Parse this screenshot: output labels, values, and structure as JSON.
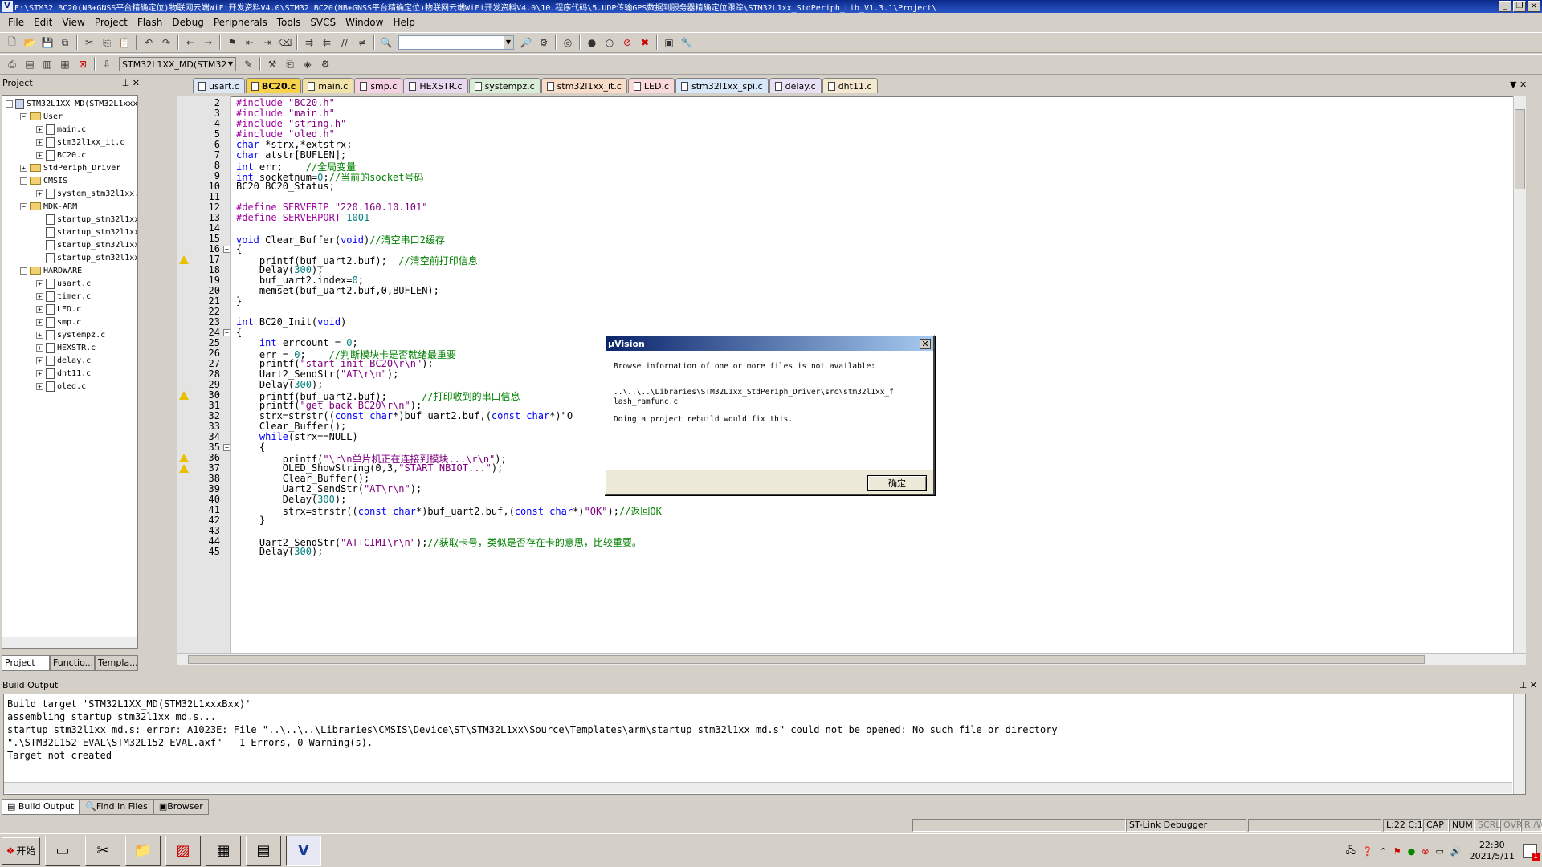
{
  "window": {
    "title": "E:\\STM32 BC20(NB+GNSS平台精确定位)物联网云端WiFi开发资料V4.0\\STM32 BC20(NB+GNSS平台精确定位)物联网云端WiFi开发资料V4.0\\10.程序代码\\5.UDP传输GPS数据到服务器精确定位跟踪\\STM32L1xx_StdPeriph_Lib_V1.3.1\\Project\\"
  },
  "menu": [
    "File",
    "Edit",
    "View",
    "Project",
    "Flash",
    "Debug",
    "Peripherals",
    "Tools",
    "SVCS",
    "Window",
    "Help"
  ],
  "toolbar": {
    "target_combo": "STM32L1XX_MD(STM32L1"
  },
  "project_panel": {
    "title": "Project",
    "root": "STM32L1XX_MD(STM32L1xxxBxx)",
    "groups": [
      {
        "name": "User",
        "files": [
          "main.c",
          "stm32l1xx_it.c",
          "BC20.c"
        ]
      },
      {
        "name": "StdPeriph_Driver",
        "files": []
      },
      {
        "name": "CMSIS",
        "files": [
          "system_stm32l1xx.c"
        ]
      },
      {
        "name": "MDK-ARM",
        "files": [
          "startup_stm32l1xx_md.",
          "startup_stm32l1xx_mdp",
          "startup_stm32l1xx_hd.",
          "startup_stm32l1xx_xl."
        ]
      },
      {
        "name": "HARDWARE",
        "files": [
          "usart.c",
          "timer.c",
          "LED.c",
          "smp.c",
          "systempz.c",
          "HEXSTR.c",
          "delay.c",
          "dht11.c",
          "oled.c"
        ]
      }
    ],
    "tabs": [
      "Project",
      "Functio...",
      "Templa..."
    ]
  },
  "file_tabs": [
    {
      "name": "usart.c",
      "color": "#dce6f5"
    },
    {
      "name": "BC20.c",
      "color": "#f7e28a"
    },
    {
      "name": "main.c",
      "color": "#f0e2a8"
    },
    {
      "name": "smp.c",
      "color": "#f5d0e0"
    },
    {
      "name": "HEXSTR.c",
      "color": "#e8d8f0"
    },
    {
      "name": "systempz.c",
      "color": "#d8ecd8"
    },
    {
      "name": "stm32l1xx_it.c",
      "color": "#f8dcc8"
    },
    {
      "name": "LED.c",
      "color": "#f8d8d8"
    },
    {
      "name": "stm32l1xx_spi.c",
      "color": "#d8e8f8"
    },
    {
      "name": "delay.c",
      "color": "#e8e0f4"
    },
    {
      "name": "dht11.c",
      "color": "#f4e8d0"
    }
  ],
  "code_lines": [
    {
      "n": "2",
      "t": "#include \"BC20.h\""
    },
    {
      "n": "3",
      "t": "#include \"main.h\""
    },
    {
      "n": "4",
      "t": "#include \"string.h\""
    },
    {
      "n": "5",
      "t": "#include \"oled.h\""
    },
    {
      "n": "6",
      "t": "char *strx,*extstrx;"
    },
    {
      "n": "7",
      "t": "char atstr[BUFLEN];"
    },
    {
      "n": "8",
      "t": "int err;    //全局变量"
    },
    {
      "n": "9",
      "t": "int socketnum=0;//当前的socket号码"
    },
    {
      "n": "10",
      "t": "BC20 BC20_Status;"
    },
    {
      "n": "11",
      "t": ""
    },
    {
      "n": "12",
      "t": "#define SERVERIP \"220.160.10.101\""
    },
    {
      "n": "13",
      "t": "#define SERVERPORT 1001"
    },
    {
      "n": "14",
      "t": ""
    },
    {
      "n": "15",
      "t": "void Clear_Buffer(void)//清空串口2缓存"
    },
    {
      "n": "16",
      "t": "{"
    },
    {
      "n": "17",
      "t": "    printf(buf_uart2.buf);  //清空前打印信息"
    },
    {
      "n": "18",
      "t": "    Delay(300);"
    },
    {
      "n": "19",
      "t": "    buf_uart2.index=0;"
    },
    {
      "n": "20",
      "t": "    memset(buf_uart2.buf,0,BUFLEN);"
    },
    {
      "n": "21",
      "t": "}"
    },
    {
      "n": "22",
      "t": ""
    },
    {
      "n": "23",
      "t": "int BC20_Init(void)"
    },
    {
      "n": "24",
      "t": "{"
    },
    {
      "n": "25",
      "t": "    int errcount = 0;"
    },
    {
      "n": "26",
      "t": "    err = 0;    //判断模块卡是否就绪最重要"
    },
    {
      "n": "27",
      "t": "    printf(\"start init BC20\\r\\n\");"
    },
    {
      "n": "28",
      "t": "    Uart2_SendStr(\"AT\\r\\n\");"
    },
    {
      "n": "29",
      "t": "    Delay(300);"
    },
    {
      "n": "30",
      "t": "    printf(buf_uart2.buf);      //打印收到的串口信息"
    },
    {
      "n": "31",
      "t": "    printf(\"get back BC20\\r\\n\");"
    },
    {
      "n": "32",
      "t": "    strx=strstr((const char*)buf_uart2.buf,(const char*)\"O"
    },
    {
      "n": "33",
      "t": "    Clear_Buffer();"
    },
    {
      "n": "34",
      "t": "    while(strx==NULL)"
    },
    {
      "n": "35",
      "t": "    {"
    },
    {
      "n": "36",
      "t": "        printf(\"\\r\\n单片机正在连接到模块...\\r\\n\");"
    },
    {
      "n": "37",
      "t": "        OLED_ShowString(0,3,\"START NBIOT...\");"
    },
    {
      "n": "38",
      "t": "        Clear_Buffer();"
    },
    {
      "n": "39",
      "t": "        Uart2_SendStr(\"AT\\r\\n\");"
    },
    {
      "n": "40",
      "t": "        Delay(300);"
    },
    {
      "n": "41",
      "t": "        strx=strstr((const char*)buf_uart2.buf,(const char*)\"OK\");//返回OK"
    },
    {
      "n": "42",
      "t": "    }"
    },
    {
      "n": "43",
      "t": ""
    },
    {
      "n": "44",
      "t": "    Uart2_SendStr(\"AT+CIMI\\r\\n\");//获取卡号，类似是否存在卡的意思，比较重要。"
    },
    {
      "n": "45",
      "t": "    Delay(300);"
    }
  ],
  "dialog": {
    "title": "µVision",
    "line1": "Browse information of one or more files is not available:",
    "line2": "..\\..\\..\\Libraries\\STM32L1xx_StdPeriph_Driver\\src\\stm32l1xx_f",
    "line3": "lash_ramfunc.c",
    "line4": "Doing a project rebuild would fix this.",
    "ok": "确定"
  },
  "build_output": {
    "title": "Build Output",
    "lines": [
      "Build target 'STM32L1XX_MD(STM32L1xxxBxx)'",
      "assembling startup_stm32l1xx_md.s...",
      "startup_stm32l1xx_md.s: error: A1023E: File \"..\\..\\..\\Libraries\\CMSIS\\Device\\ST\\STM32L1xx\\Source\\Templates\\arm\\startup_stm32l1xx_md.s\" could not be opened: No such file or directory",
      "\".\\STM32L152-EVAL\\STM32L152-EVAL.axf\" - 1 Errors, 0 Warning(s).",
      "Target not created"
    ],
    "tabs": [
      "Build Output",
      "Find In Files",
      "Browser"
    ]
  },
  "status": {
    "debugger": "ST-Link Debugger",
    "position": "L:22 C:1",
    "cap": "CAP",
    "num": "NUM",
    "scrl": "SCRL",
    "ovr": "OVR",
    "rw": "R /W"
  },
  "taskbar": {
    "start": "开始",
    "time": "22:30",
    "date": "2021/5/11",
    "badge": "1"
  }
}
